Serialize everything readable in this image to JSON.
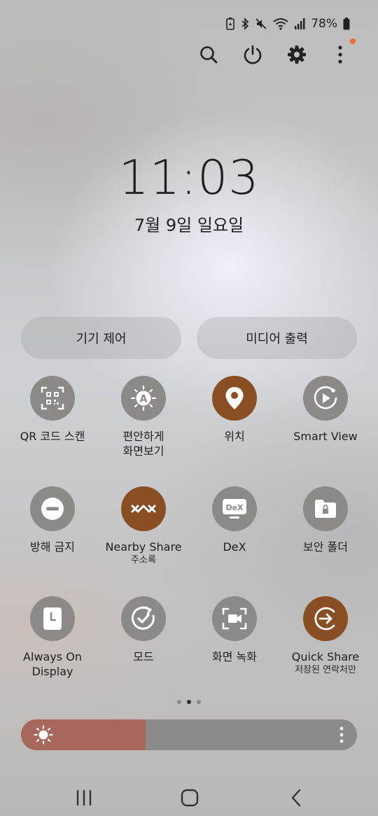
{
  "status": {
    "battery_text": "78%"
  },
  "clock": {
    "time": "11:03",
    "date": "7월 9일 일요일"
  },
  "panels": {
    "device_control": "기기 제어",
    "media_output": "미디어 출력"
  },
  "tiles": [
    {
      "label": "QR 코드 스캔",
      "sublabel": "",
      "active": false,
      "icon": "qr-scan-icon"
    },
    {
      "label": "편안하게\n화면보기",
      "sublabel": "",
      "active": false,
      "icon": "eye-comfort-icon"
    },
    {
      "label": "위치",
      "sublabel": "",
      "active": true,
      "icon": "location-pin-icon"
    },
    {
      "label": "Smart View",
      "sublabel": "",
      "active": false,
      "icon": "smart-view-icon"
    },
    {
      "label": "방해 금지",
      "sublabel": "",
      "active": false,
      "icon": "do-not-disturb-icon"
    },
    {
      "label": "Nearby Share",
      "sublabel": "주소록",
      "active": true,
      "icon": "nearby-share-icon"
    },
    {
      "label": "DeX",
      "sublabel": "",
      "active": false,
      "icon": "dex-icon"
    },
    {
      "label": "보안 폴더",
      "sublabel": "",
      "active": false,
      "icon": "secure-folder-icon"
    },
    {
      "label": "Always On\nDisplay",
      "sublabel": "",
      "active": false,
      "icon": "always-on-display-icon"
    },
    {
      "label": "모드",
      "sublabel": "",
      "active": false,
      "icon": "modes-icon"
    },
    {
      "label": "화면 녹화",
      "sublabel": "",
      "active": false,
      "icon": "screen-recorder-icon"
    },
    {
      "label": "Quick Share",
      "sublabel": "저장된 연락처만",
      "active": true,
      "icon": "quick-share-icon"
    }
  ],
  "dex_icon_text": "DeX",
  "brightness": {
    "level": 0.37,
    "fill_color": "#a8675b"
  },
  "colors": {
    "active_tile": "#8a4e23",
    "inactive_tile": "#8c8a89",
    "notification_dot": "#f06a2a"
  }
}
